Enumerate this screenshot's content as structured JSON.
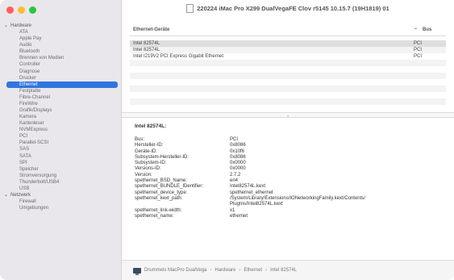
{
  "window": {
    "title": "220224 iMac Pro X299 DualVegaFE Clov r5145 10.15.7 (19H1819) 01"
  },
  "sidebar": {
    "groups": [
      {
        "label": "Hardware",
        "expanded": true,
        "items": [
          "ATA",
          "Apple Pay",
          "Audio",
          "Bluetooth",
          "Brennen von Medien",
          "Controller",
          "Diagnose",
          "Drucker",
          "Ethernet",
          "Festplatte",
          "Fibre-Channel",
          "FireWire",
          "Grafik/Displays",
          "Kamera",
          "Kartenleser",
          "NVMExpress",
          "PCI",
          "Parallel-SCSI",
          "SAS",
          "SATA",
          "SPI",
          "Speicher",
          "Stromversorgung",
          "Thunderbolt/USB4",
          "USB"
        ]
      },
      {
        "label": "Netzwerk",
        "expanded": true,
        "items": [
          "Firewall",
          "Umgebungen"
        ]
      }
    ],
    "selected": "Ethernet"
  },
  "table": {
    "col_name": "Ethernet-Geräte",
    "col_bus": "Bus",
    "rows": [
      {
        "name": "Intel 82574L",
        "bus": "PCI"
      },
      {
        "name": "Intel 82574L",
        "bus": "PCI"
      },
      {
        "name": "Intel I219V2 PCI Express Gigabit Ethernet",
        "bus": "PCI"
      }
    ]
  },
  "detail": {
    "title": "Intel 82574L:",
    "fields": [
      {
        "k": "Bus:",
        "v": "PCI"
      },
      {
        "k": "Hersteller-ID:",
        "v": "0x8086"
      },
      {
        "k": "Geräte-ID:",
        "v": "0x10f6"
      },
      {
        "k": "Subsystem-Hersteller-ID:",
        "v": "0x8086"
      },
      {
        "k": "Subsystem-ID:",
        "v": "0x0000"
      },
      {
        "k": "Versions-ID:",
        "v": "0x0000"
      },
      {
        "k": "Version:",
        "v": "2.7.2"
      },
      {
        "k": "spethernet_BSD_Name:",
        "v": "en4"
      },
      {
        "k": "spethernet_BUNDLE_IDentifier:",
        "v": "Intel82574L.kext"
      },
      {
        "k": "spethernet_device_type:",
        "v": "spethernet_ethernet"
      },
      {
        "k": "spethernet_kext_path:",
        "v": "/System/Library/Extensions/IONetworkingFamily.kext/Contents/"
      },
      {
        "k": "",
        "v": "PlugIns/Intel82574L.kext"
      },
      {
        "k": "spethernet_link-width:",
        "v": "x1"
      },
      {
        "k": "spethernet_name:",
        "v": "ethernet"
      }
    ]
  },
  "pathbar": {
    "crumbs": [
      "Drummels MacPro DualVega",
      "Hardware",
      "Ethernet",
      "Intel 82574L"
    ]
  }
}
